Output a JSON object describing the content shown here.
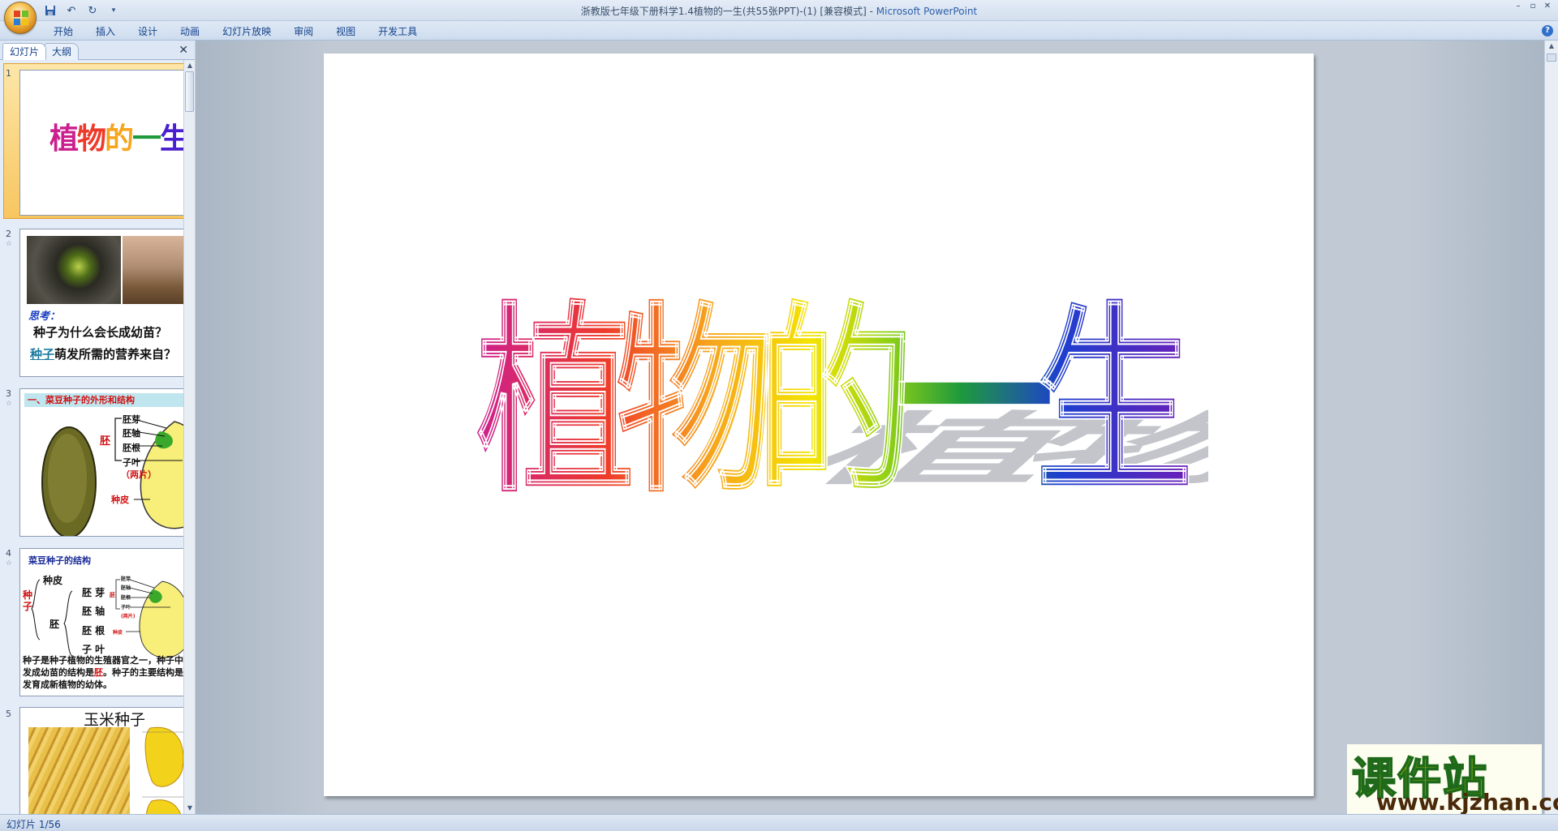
{
  "window": {
    "title": "浙教版七年级下册科学1.4植物的一生(共55张PPT)-(1) [兼容模式] - ",
    "app_name": "Microsoft PowerPoint"
  },
  "ribbon": {
    "tabs": [
      "开始",
      "插入",
      "设计",
      "动画",
      "幻灯片放映",
      "审阅",
      "视图",
      "开发工具"
    ]
  },
  "left_pane": {
    "tabs": {
      "slides": "幻灯片",
      "outline": "大纲"
    },
    "slides": [
      {
        "number": "1",
        "title": "植物的一生"
      },
      {
        "number": "2",
        "heading": "思考：",
        "line1": "种子为什么会长成幼苗？",
        "line2_link": "种子",
        "line2_rest": "萌发所需的营养来自？"
      },
      {
        "number": "3",
        "heading": "一、菜豆种子的外形和结构",
        "labels": [
          "胚芽",
          "胚轴",
          "胚根",
          "子叶",
          "（两片）",
          "胚",
          "种皮"
        ]
      },
      {
        "number": "4",
        "heading": "菜豆种子的结构",
        "tree": {
          "root": "种子",
          "a": "种皮",
          "b": "胚",
          "parts": [
            "胚 芽",
            "胚 轴",
            "胚 根",
            "子 叶"
          ]
        },
        "mini_labels": [
          "胚芽",
          "胚轴",
          "胚根",
          "子叶",
          "(两片)",
          "胚",
          "种皮"
        ],
        "text_pre": "种子是种子植物的生殖器官之一，种子中将来萌发成幼苗的结构是",
        "text_red1": "胚",
        "text_mid": "。种子的主要结构是",
        "text_red2": "胚",
        "text_post": "——发育成新植物的幼体。"
      },
      {
        "number": "5",
        "heading": "玉米种子"
      }
    ]
  },
  "slide": {
    "title_chars": [
      "植",
      "物",
      "的",
      "一",
      "生"
    ],
    "colors": {
      "c1": "#cc1f8f",
      "c2": "#ee3a2a",
      "c3": "#f7a51d",
      "c4": "#8fd016",
      "c5": "#1e9a3c",
      "c6": "#1e3fd0",
      "c7": "#6a1fb8"
    }
  },
  "status": {
    "slide_counter": "幻灯片 1/56"
  },
  "watermark": {
    "name": "课件站",
    "url": "www.kjzhan.com"
  }
}
